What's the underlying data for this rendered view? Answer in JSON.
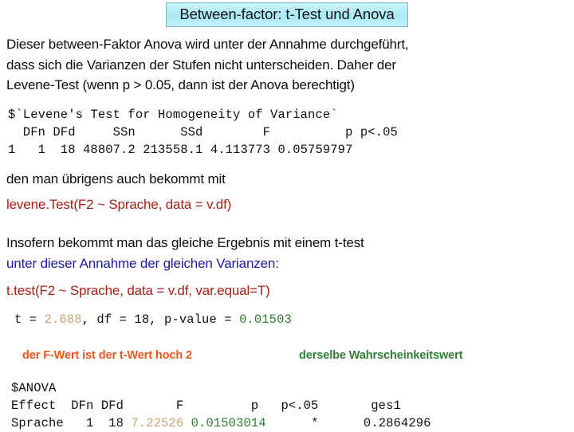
{
  "slide": {
    "title": "Between-factor: t-Test und Anova",
    "title_bg": "#b6ecf7",
    "title_border": "#6fb6c6"
  },
  "paragraphs": {
    "intro": "Dieser between-Faktor Anova wird unter der Annahme durchgeführt,\ndass sich die Varianzen der Stufen nicht unterscheiden. Daher der\nLevene-Test (wenn p > 0.05, dann ist der Anova berechtigt)",
    "den_man": "den man übrigens auch bekommt mit",
    "insofern": "Insofern bekommt man das gleiche Ergebnis mit einem t-test",
    "annahme": "unter dieser Annahme der gleichen Varianzen:"
  },
  "code_calls": {
    "levene": "levene.Test(F2 ~ Sprache, data = v.df)",
    "ttest": "t.test(F2 ~ Sprache, data = v.df, var.equal=T)",
    "color": "#a52019"
  },
  "levene_output": {
    "header_line": "$`Levene's Test for Homogeneity of Variance`",
    "columns_line": "  DFn DFd     SSn      SSd        F          p p<.05",
    "values_line": "1   1  18 48807.2 213558.1 4.113773 0.05759797",
    "columns": [
      "",
      "DFn",
      "DFd",
      "SSn",
      "SSd",
      "F",
      "p",
      "p<.05"
    ],
    "row": [
      "1",
      "1",
      "18",
      "48807.2",
      "213558.1",
      "4.113773",
      "0.05759797",
      ""
    ]
  },
  "ttest_output": {
    "prefix": "t = ",
    "t_value": "2.688",
    "middle": ", df = 18, p-value = ",
    "p_value": "0.01503",
    "full_line": "t = 2.688, df = 18, p-value = 0.01503"
  },
  "annotations": {
    "f_wert": "der F-Wert ist der t-Wert hoch 2",
    "f_wert_color": "#e2591a",
    "wahrscheinkeitswert": "derselbe Wahrscheinkeitswert",
    "wahrscheinkeitswert_color": "#2f7d35"
  },
  "anova_output": {
    "title_line": "$ANOVA",
    "header_line": "Effect  DFn DFd       F         p   p<.05       ges1",
    "row_prefix": "Sprache   1  18 ",
    "f_value": "7.22526",
    "sep1": " ",
    "p_value": "0.01503014",
    "sep2": "      ",
    "star": "*",
    "sep3": "      ",
    "ges": "0.2864296",
    "columns": [
      "Effect",
      "DFn",
      "DFd",
      "F",
      "p",
      "p<.05",
      "ges1"
    ],
    "row": [
      "Sprache",
      "1",
      "18",
      "7.22526",
      "0.01503014",
      "*",
      "0.2864296"
    ],
    "f_color": "#c9a570",
    "p_color": "#2f7d35"
  }
}
